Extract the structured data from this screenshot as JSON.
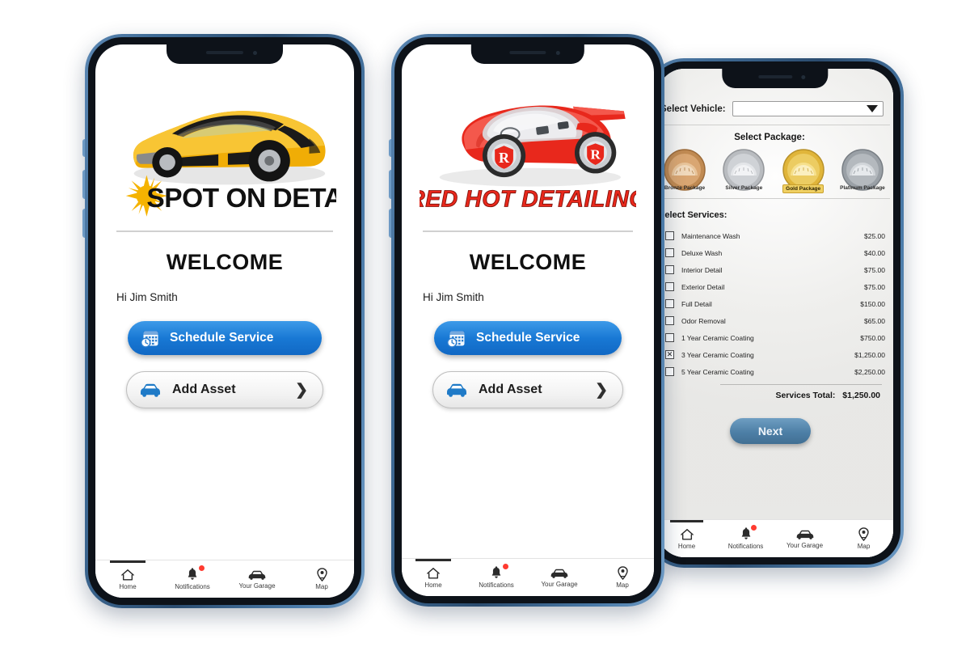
{
  "phones": {
    "phone1": {
      "brand": {
        "name": "SPOT ON DETAILING",
        "car_color": "#f2b705",
        "text_color": "#111111",
        "burst_color": "#f5b301"
      },
      "welcome_title": "WELCOME",
      "greeting": "Hi Jim Smith",
      "schedule_button": "Schedule Service",
      "add_asset_button": "Add Asset",
      "chevron": "❯"
    },
    "phone2": {
      "brand": {
        "name": "RED HOT DETAILING",
        "car_color": "#e8281c",
        "text_color": "#e8281c",
        "emblem_letter": "R"
      },
      "welcome_title": "WELCOME",
      "greeting": "Hi Jim Smith",
      "schedule_button": "Schedule Service",
      "add_asset_button": "Add Asset",
      "chevron": "❯"
    },
    "phone3": {
      "vehicle_label": "Select Vehicle:",
      "vehicle_value": "",
      "package_title": "Select Package:",
      "packages": [
        {
          "label": "Bronze Package",
          "selected": false,
          "color": "#c08a52"
        },
        {
          "label": "Silver Package",
          "selected": false,
          "color": "#b9bcc0"
        },
        {
          "label": "Gold Package",
          "selected": true,
          "color": "#e0b53a"
        },
        {
          "label": "Platinum Package",
          "selected": false,
          "color": "#9aa0a6"
        }
      ],
      "services_title": "Select Services:",
      "services": [
        {
          "name": "Maintenance Wash",
          "price": "$25.00",
          "checked": false
        },
        {
          "name": "Deluxe Wash",
          "price": "$40.00",
          "checked": false
        },
        {
          "name": "Interior Detail",
          "price": "$75.00",
          "checked": false
        },
        {
          "name": "Exterior Detail",
          "price": "$75.00",
          "checked": false
        },
        {
          "name": "Full Detail",
          "price": "$150.00",
          "checked": false
        },
        {
          "name": "Odor Removal",
          "price": "$65.00",
          "checked": false
        },
        {
          "name": "1 Year Ceramic Coating",
          "price": "$750.00",
          "checked": false
        },
        {
          "name": "3 Year Ceramic Coating",
          "price": "$1,250.00",
          "checked": true
        },
        {
          "name": "5 Year Ceramic Coating",
          "price": "$2,250.00",
          "checked": false
        }
      ],
      "services_total_label": "Services Total:",
      "services_total_value": "$1,250.00",
      "next_button": "Next"
    }
  },
  "tabbar": {
    "items": [
      {
        "label": "Home",
        "icon": "home-icon",
        "active": true,
        "badge": false
      },
      {
        "label": "Notifications",
        "icon": "bell-icon",
        "active": false,
        "badge": true
      },
      {
        "label": "Your Garage",
        "icon": "car-front-icon",
        "active": false,
        "badge": false
      },
      {
        "label": "Map",
        "icon": "map-pin-icon",
        "active": false,
        "badge": false
      }
    ]
  },
  "theme": {
    "page_background": "#ffffff",
    "frame_outer": "#3f6b96",
    "frame_bezel": "#0d1219",
    "primary_blue": "#1878d4",
    "next_blue": "#4d7fa6",
    "badge_red": "#ff3b30"
  }
}
